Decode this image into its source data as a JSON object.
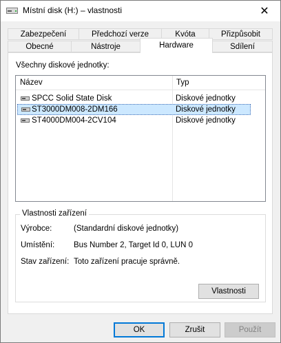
{
  "window": {
    "title": "Místní disk (H:) – vlastnosti",
    "close_glyph": "✕"
  },
  "tabs_row1": [
    "Zabezpečení",
    "Předchozí verze",
    "Kvóta",
    "Přizpůsobit"
  ],
  "tabs_row2": [
    "Obecné",
    "Nástroje",
    "Hardware",
    "Sdílení"
  ],
  "active_tab": "Hardware",
  "hardware": {
    "all_drives_label": "Všechny diskové jednotky:",
    "columns": {
      "name": "Název",
      "type": "Typ"
    },
    "rows": [
      {
        "name": "SPCC Solid State Disk",
        "type": "Diskové jednotky",
        "selected": false
      },
      {
        "name": "ST3000DM008-2DM166",
        "type": "Diskové jednotky",
        "selected": true
      },
      {
        "name": "ST4000DM004-2CV104",
        "type": "Diskové jednotky",
        "selected": false
      }
    ],
    "device_props": {
      "title": "Vlastnosti zařízení",
      "manufacturer_label": "Výrobce:",
      "manufacturer_value": "(Standardní diskové jednotky)",
      "location_label": "Umístění:",
      "location_value": "Bus Number 2, Target Id 0, LUN 0",
      "status_label": "Stav zařízení:",
      "status_value": "Toto zařízení pracuje správně.",
      "properties_button": "Vlastnosti"
    }
  },
  "footer": {
    "ok": "OK",
    "cancel": "Zrušit",
    "apply": "Použít"
  },
  "colors": {
    "selection": "#cce8ff",
    "accent": "#0078d7"
  }
}
